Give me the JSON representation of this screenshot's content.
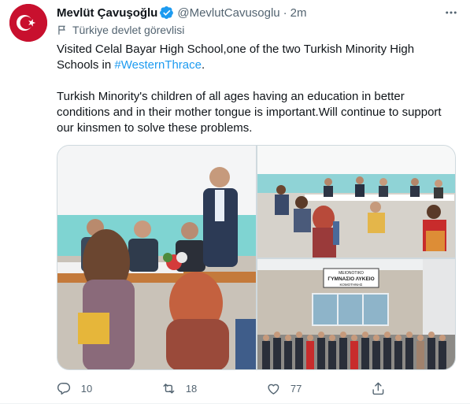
{
  "author": {
    "name": "Mevlüt Çavuşoğlu",
    "handle": "@MevlutCavusoglu",
    "separator": "·",
    "time": "2m",
    "label": "Türkiye devlet görevlisi"
  },
  "tweet": {
    "line1": "Visited Celal Bayar High School,one of the two Turkish Minority High",
    "line2_prefix": "Schools in ",
    "hashtag": "#WesternThrace",
    "line2_suffix": ".",
    "para2_line1": "Turkish Minority's children of all ages having an education in better",
    "para2_line2": "conditions and in their mother tongue is important.Will continue to support",
    "para2_line3": "our kinsmen to solve these problems."
  },
  "media": {
    "school_sign_line1": "ΜΕΙΟΝΟΤΙΚΟ",
    "school_sign_line2": "ΓΥΜΝΑΣΙΟ ΛΥΚΕΙΟ",
    "school_sign_line3": "ΚΟΜΟΤΗΝΗΣ"
  },
  "actions": {
    "replies": "10",
    "retweets": "18",
    "likes": "77"
  },
  "colors": {
    "accent": "#1d9bf0",
    "secondary_text": "#536471",
    "avatar_bg": "#c8102e"
  },
  "icons": [
    "flag-avatar",
    "verified-badge-icon",
    "more-icon",
    "government-flag-icon",
    "reply-icon",
    "retweet-icon",
    "like-icon",
    "share-icon"
  ]
}
